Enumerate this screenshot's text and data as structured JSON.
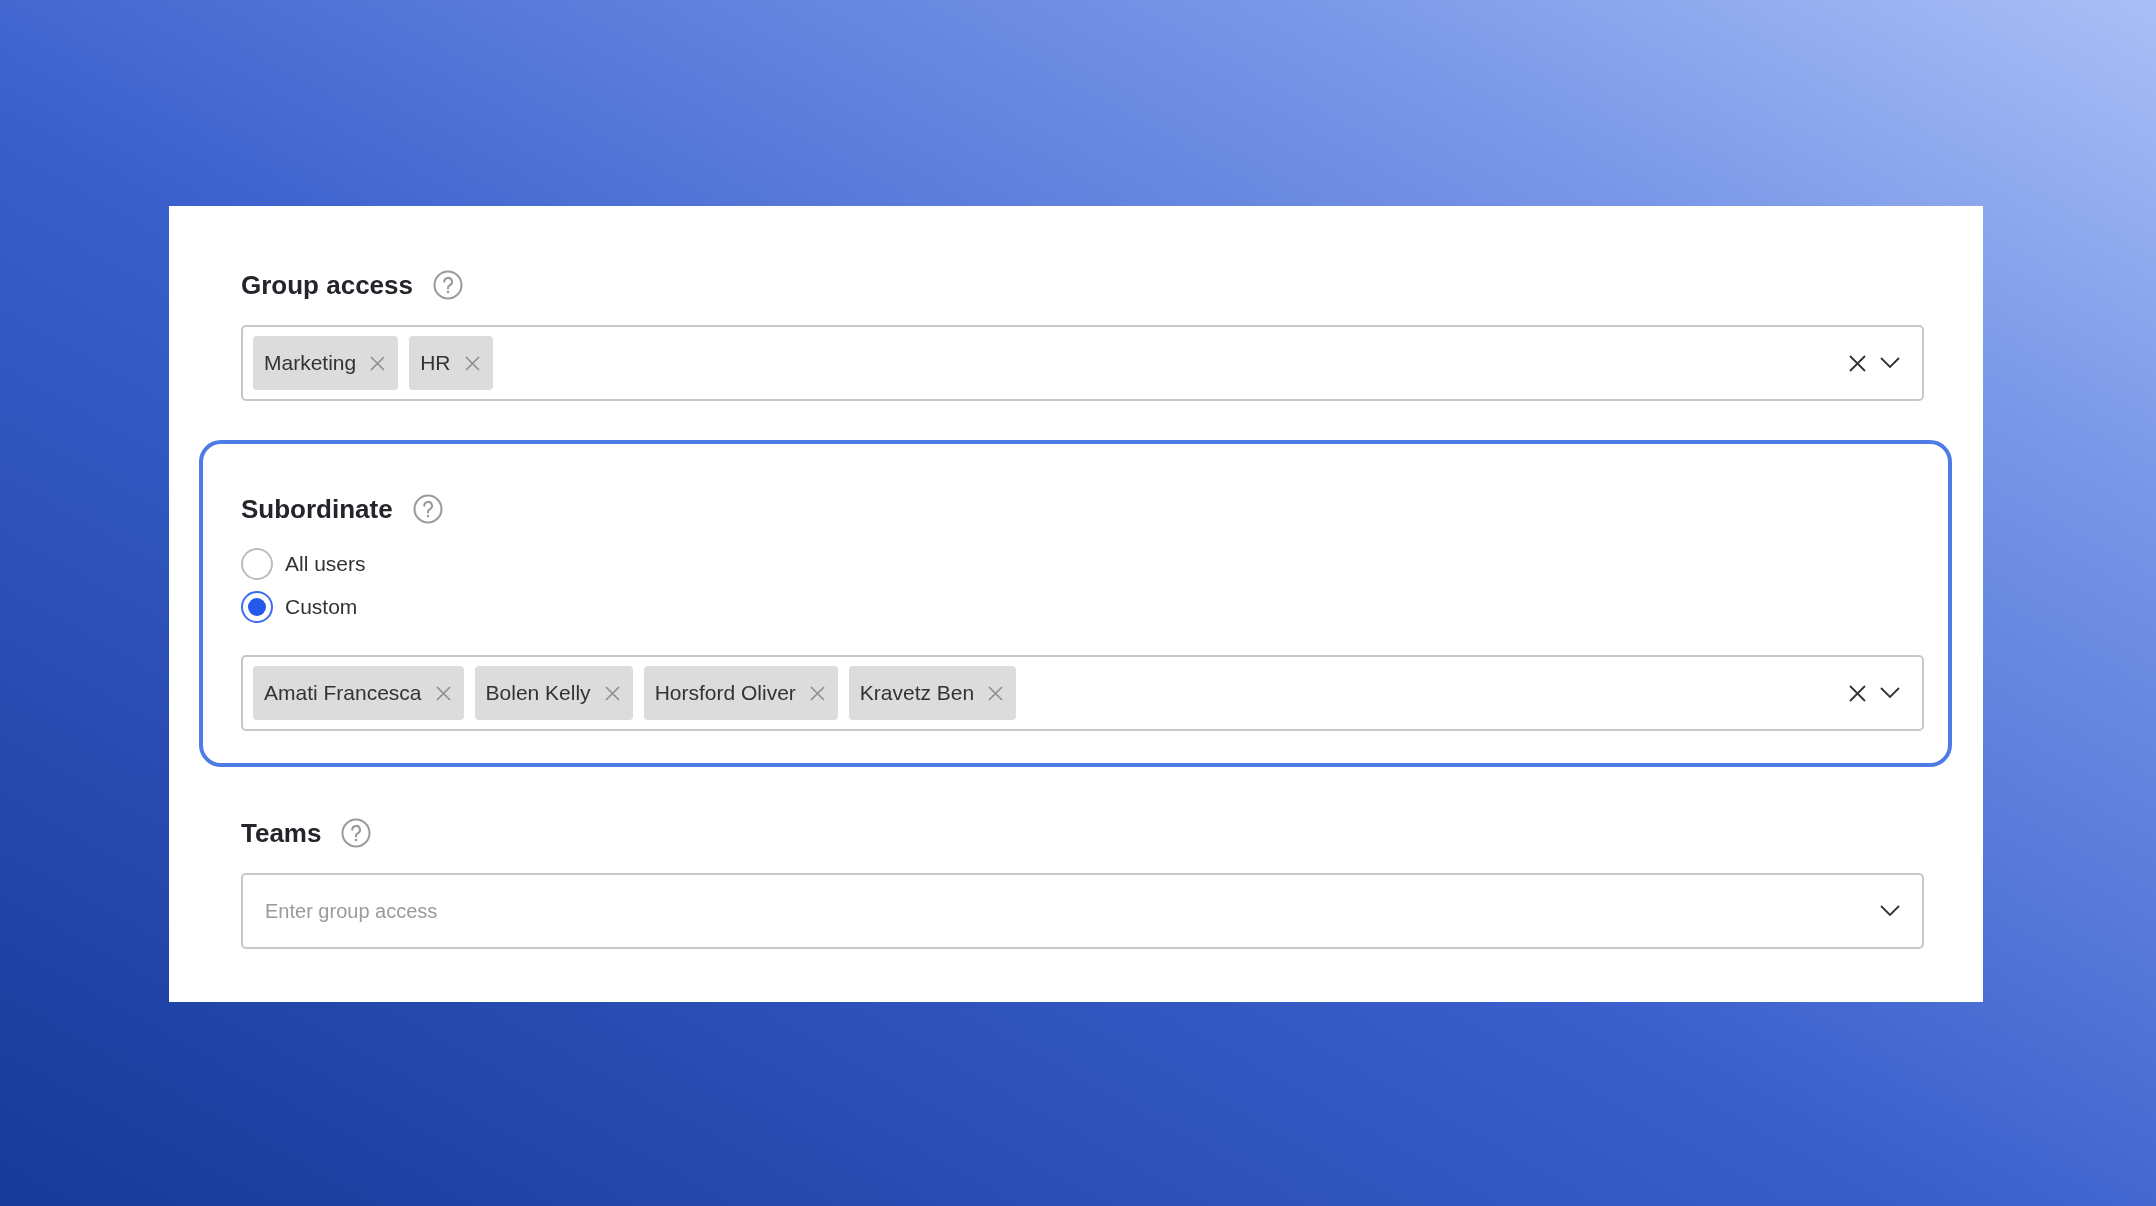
{
  "sections": [
    {
      "label": "Group access",
      "highlighted": false,
      "field": {
        "tags": [
          "Marketing",
          "HR"
        ]
      }
    },
    {
      "label": "Subordinate",
      "highlighted": true,
      "options": [
        {
          "label": "All users",
          "selected": false
        },
        {
          "label": "Custom",
          "selected": true
        }
      ],
      "field": {
        "tags": [
          "Amati Francesca",
          "Bolen Kelly",
          "Horsford Oliver",
          "Kravetz Ben"
        ]
      }
    },
    {
      "label": "Teams",
      "highlighted": false,
      "field": {
        "placeholder": "Enter group access"
      }
    }
  ]
}
